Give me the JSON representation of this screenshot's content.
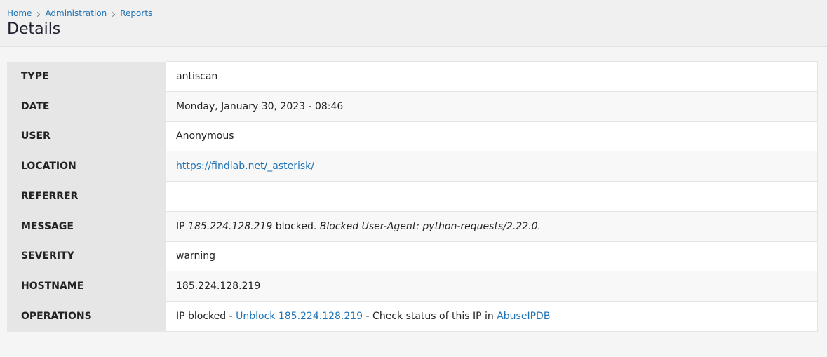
{
  "breadcrumb": [
    "Home",
    "Administration",
    "Reports"
  ],
  "page_title": "Details",
  "rows": {
    "type": {
      "label": "TYPE",
      "value": "antiscan"
    },
    "date": {
      "label": "DATE",
      "value": "Monday, January 30, 2023 - 08:46"
    },
    "user": {
      "label": "USER",
      "value": "Anonymous"
    },
    "location": {
      "label": "LOCATION",
      "value": "https://findlab.net/_asterisk/"
    },
    "referrer": {
      "label": "REFERRER",
      "value": ""
    },
    "message": {
      "label": "MESSAGE",
      "prefix": "IP ",
      "ip": "185.224.128.219",
      "middle": " blocked. ",
      "detail": "Blocked User-Agent: python-requests/2.22.0."
    },
    "severity": {
      "label": "SEVERITY",
      "value": "warning"
    },
    "hostname": {
      "label": "HOSTNAME",
      "value": "185.224.128.219"
    },
    "operations": {
      "label": "OPERATIONS",
      "prefix": "IP blocked - ",
      "unblock_link": "Unblock 185.224.128.219",
      "middle": " - Check status of this IP in ",
      "abuse_link": "AbuseIPDB"
    }
  }
}
